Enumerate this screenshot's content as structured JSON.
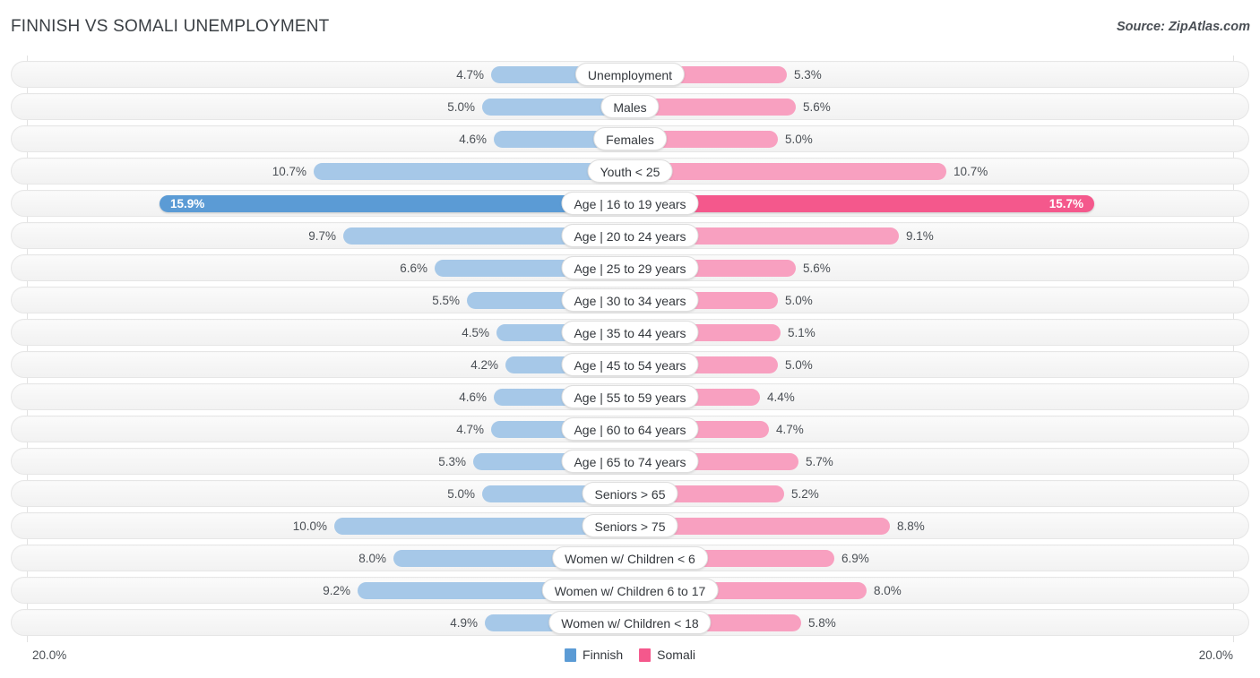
{
  "header": {
    "title": "FINNISH VS SOMALI UNEMPLOYMENT",
    "source": "Source: ZipAtlas.com"
  },
  "footer": {
    "axis_min_left": "20.0%",
    "axis_min_right": "20.0%",
    "legend": [
      {
        "label": "Finnish",
        "color": "#5B9BD5"
      },
      {
        "label": "Somali",
        "color": "#F4588C"
      }
    ]
  },
  "colors": {
    "left_normal": "#A6C8E8",
    "left_highlight": "#5B9BD5",
    "right_normal": "#F8A0C0",
    "right_highlight": "#F4588C",
    "track": "#F6F6F6",
    "gridline": "#E2E2E2",
    "text": "#4A4F55"
  },
  "chart_data": {
    "type": "bar",
    "subtype": "diverging-butterfly",
    "title": "FINNISH VS SOMALI UNEMPLOYMENT",
    "xlabel": "",
    "ylabel": "",
    "axis_max": 20.0,
    "axis_unit": "%",
    "grid": true,
    "legend_position": "bottom-center",
    "categories": [
      "Unemployment",
      "Males",
      "Females",
      "Youth < 25",
      "Age | 16 to 19 years",
      "Age | 20 to 24 years",
      "Age | 25 to 29 years",
      "Age | 30 to 34 years",
      "Age | 35 to 44 years",
      "Age | 45 to 54 years",
      "Age | 55 to 59 years",
      "Age | 60 to 64 years",
      "Age | 65 to 74 years",
      "Seniors > 65",
      "Seniors > 75",
      "Women w/ Children < 6",
      "Women w/ Children 6 to 17",
      "Women w/ Children < 18"
    ],
    "series": [
      {
        "name": "Finnish",
        "side": "left",
        "color": "#A6C8E8",
        "values": [
          4.7,
          5.0,
          4.6,
          10.7,
          15.9,
          9.7,
          6.6,
          5.5,
          4.5,
          4.2,
          4.6,
          4.7,
          5.3,
          5.0,
          10.0,
          8.0,
          9.2,
          4.9
        ],
        "labels": [
          "4.7%",
          "5.0%",
          "4.6%",
          "10.7%",
          "15.9%",
          "9.7%",
          "6.6%",
          "5.5%",
          "4.5%",
          "4.2%",
          "4.6%",
          "4.7%",
          "5.3%",
          "5.0%",
          "10.0%",
          "8.0%",
          "9.2%",
          "4.9%"
        ]
      },
      {
        "name": "Somali",
        "side": "right",
        "color": "#F8A0C0",
        "values": [
          5.3,
          5.6,
          5.0,
          10.7,
          15.7,
          9.1,
          5.6,
          5.0,
          5.1,
          5.0,
          4.4,
          4.7,
          5.7,
          5.2,
          8.8,
          6.9,
          8.0,
          5.8
        ],
        "labels": [
          "5.3%",
          "5.6%",
          "5.0%",
          "10.7%",
          "15.7%",
          "9.1%",
          "5.6%",
          "5.0%",
          "5.1%",
          "5.0%",
          "4.4%",
          "4.7%",
          "5.7%",
          "5.2%",
          "8.8%",
          "6.9%",
          "8.0%",
          "5.8%"
        ]
      }
    ],
    "highlighted_row": "Age | 16 to 19 years"
  }
}
